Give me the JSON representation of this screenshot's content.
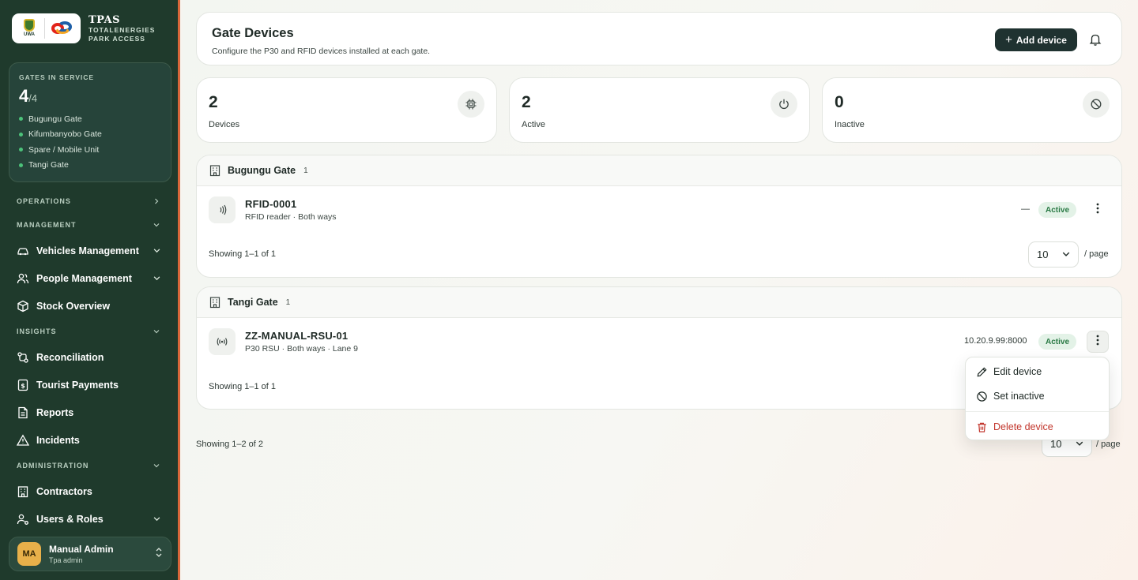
{
  "brand": {
    "title": "TPAS",
    "subtitle_line1": "TOTALENERGIES",
    "subtitle_line2": "PARK ACCESS",
    "uwa_text": "UWA"
  },
  "gates_card": {
    "label": "GATES IN SERVICE",
    "count": "4",
    "total": "/4",
    "gates": [
      "Bugungu Gate",
      "Kifumbanyobo Gate",
      "Spare / Mobile Unit",
      "Tangi Gate"
    ]
  },
  "nav": {
    "operations": "OPERATIONS",
    "management": "MANAGEMENT",
    "vehicles": "Vehicles Management",
    "people": "People Management",
    "stock": "Stock Overview",
    "insights": "INSIGHTS",
    "reconciliation": "Reconciliation",
    "tourist_payments": "Tourist Payments",
    "reports": "Reports",
    "incidents": "Incidents",
    "administration": "ADMINISTRATION",
    "contractors": "Contractors",
    "users_roles": "Users & Roles"
  },
  "user": {
    "initials": "MA",
    "name": "Manual Admin",
    "role": "Tpa admin"
  },
  "header": {
    "title": "Gate Devices",
    "subtitle": "Configure the P30 and RFID devices installed at each gate.",
    "add_button": "Add device"
  },
  "stats": {
    "devices": {
      "value": "2",
      "label": "Devices"
    },
    "active": {
      "value": "2",
      "label": "Active"
    },
    "inactive": {
      "value": "0",
      "label": "Inactive"
    }
  },
  "groups": [
    {
      "name": "Bugungu Gate",
      "count": "1",
      "device": {
        "name": "RFID-0001",
        "meta": "RFID reader · Both ways",
        "ip": "—",
        "status": "Active"
      },
      "showing": "Showing 1–1 of 1",
      "page_size": "10",
      "per_page": "/ page"
    },
    {
      "name": "Tangi Gate",
      "count": "1",
      "device": {
        "name": "ZZ-MANUAL-RSU-01",
        "meta": "P30 RSU · Both ways · Lane 9",
        "ip": "10.20.9.99:8000",
        "status": "Active"
      },
      "showing": "Showing 1–1 of 1"
    }
  ],
  "footer": {
    "showing": "Showing 1–2 of 2",
    "page_size": "10",
    "per_page": "/ page"
  },
  "menu": {
    "edit": "Edit device",
    "set_inactive": "Set inactive",
    "delete": "Delete device"
  },
  "colors": {
    "sidebar": "#1f3a2c",
    "accent_dark": "#1f3230",
    "active_badge_bg": "#e3f2e7",
    "active_badge_text": "#2a7a45",
    "danger": "#c2352b"
  }
}
